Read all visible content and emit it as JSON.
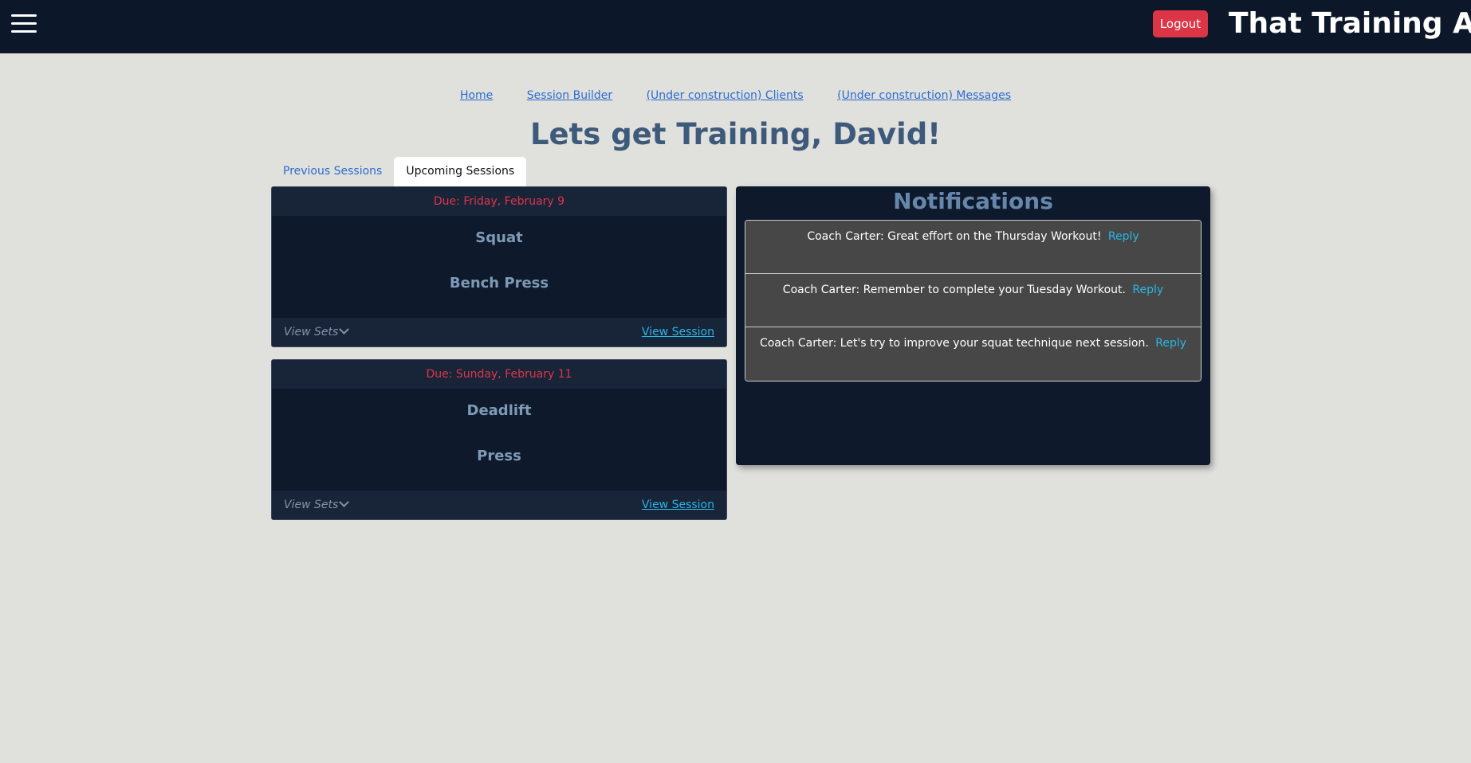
{
  "header": {
    "menu_icon": "hamburger-icon",
    "logout_label": "Logout",
    "app_title": "That Training App"
  },
  "nav": {
    "links": [
      "Home",
      "Session Builder",
      "(Under construction) Clients",
      "(Under construction) Messages"
    ]
  },
  "page_title": "Lets get Training, David!",
  "tabs": [
    {
      "label": "Previous Sessions",
      "active": false
    },
    {
      "label": "Upcoming Sessions",
      "active": true
    }
  ],
  "sessions": [
    {
      "due": "Due: Friday, February 9",
      "exercises": [
        "Squat",
        "Bench Press"
      ],
      "view_sets": "View Sets",
      "view_session": "View Session"
    },
    {
      "due": "Due: Sunday, February 11",
      "exercises": [
        "Deadlift",
        "Press"
      ],
      "view_sets": "View Sets",
      "view_session": "View Session"
    }
  ],
  "notifications": {
    "title": "Notifications",
    "items": [
      {
        "text": "Coach Carter: Great effort on the Thursday Workout!",
        "reply": "Reply"
      },
      {
        "text": "Coach Carter: Remember to complete your Tuesday Workout.",
        "reply": "Reply"
      },
      {
        "text": "Coach Carter: Let's try to improve your squat technique next session.",
        "reply": "Reply"
      }
    ]
  },
  "colors": {
    "topbar": "#0c1829",
    "logout": "#dc3545",
    "due_text": "#e0344a",
    "link": "#2b6cd0",
    "reply": "#29b6e8"
  }
}
